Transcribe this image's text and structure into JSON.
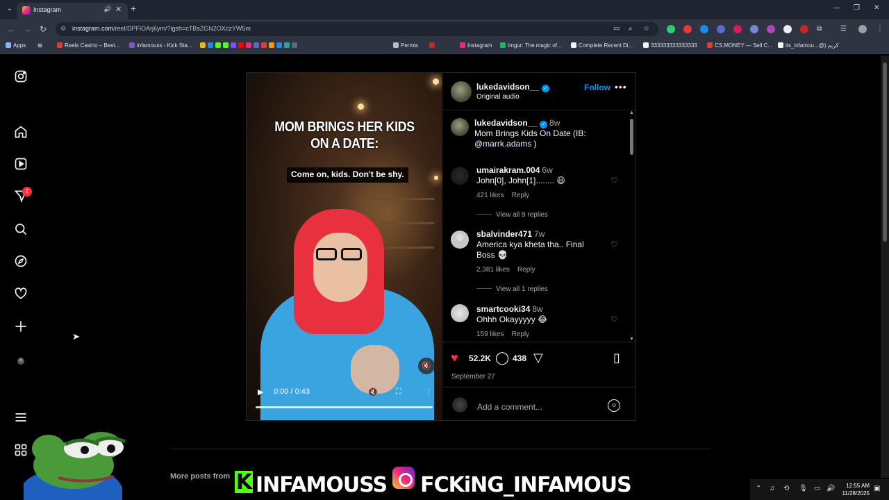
{
  "browser": {
    "tab_title": "Instagram",
    "url_domain": "instagram.com",
    "url_path": "/reel/DPFiOArj6ym/?igsh=cTBsZGN2OXczYW5m",
    "bookmarks": [
      {
        "label": "Apps",
        "color": "#8ab4f8"
      },
      {
        "label": "Reels Casino – Best...",
        "color": "#e53935"
      },
      {
        "label": "infamouss - Kick Sta...",
        "color": "#7e57c2"
      },
      {
        "label": "Permis",
        "color": "#bdbdbd"
      },
      {
        "label": "Instagram",
        "color": "#ee2a7b"
      },
      {
        "label": "Imgur: The magic of...",
        "color": "#1bb76e"
      },
      {
        "label": "Complete Recent Di...",
        "color": "#f5f5f5"
      },
      {
        "label": "333333333333333",
        "color": "#f5f5f5"
      },
      {
        "label": "CS.MONEY — Sell C...",
        "color": "#e53935"
      },
      {
        "label": "its_infamou...@) كريم",
        "color": "#f5f5f5"
      }
    ]
  },
  "sidebar": {
    "notification_badge": "1"
  },
  "post": {
    "video": {
      "headline": "MOM BRINGS HER KIDS ON A DATE:",
      "subtitle": "Come on, kids. Don't be shy.",
      "time": "0:00 / 0:43"
    },
    "author": {
      "username": "lukedavidson__",
      "audio": "Original audio",
      "follow_label": "Follow"
    },
    "caption": {
      "username": "lukedavidson__",
      "age": "8w",
      "text": "Mom Brings Kids On Date (IB: ",
      "mention": "@marrk.adams",
      "text_end": " )"
    },
    "comments": [
      {
        "username": "umairakram.004",
        "age": "6w",
        "text": "John[0], John[1]........ 😃",
        "likes": "421 likes",
        "reply": "Reply",
        "view_replies": "View all 9 replies"
      },
      {
        "username": "sbalvinder471",
        "age": "7w",
        "text": "America kya kheta tha.. Final Boss 💀",
        "likes": "2,381 likes",
        "reply": "Reply",
        "view_replies": "View all 1 replies"
      },
      {
        "username": "smartcooki34",
        "age": "8w",
        "text": "Ohhh Okayyyyy 😂",
        "likes": "159 likes",
        "reply": "Reply"
      }
    ],
    "like_count": "52.2K",
    "comment_count": "438",
    "date": "September 27",
    "comment_placeholder": "Add a comment..."
  },
  "page": {
    "more_posts_label": "More posts from"
  },
  "overlay": {
    "kick_handle": "INFAMOUSS",
    "ig_handle": "FCKiNG_INFAMOUS",
    "kick_letter": "K"
  },
  "taskbar": {
    "time": "12:55 AM",
    "date": "11/28/2025"
  }
}
